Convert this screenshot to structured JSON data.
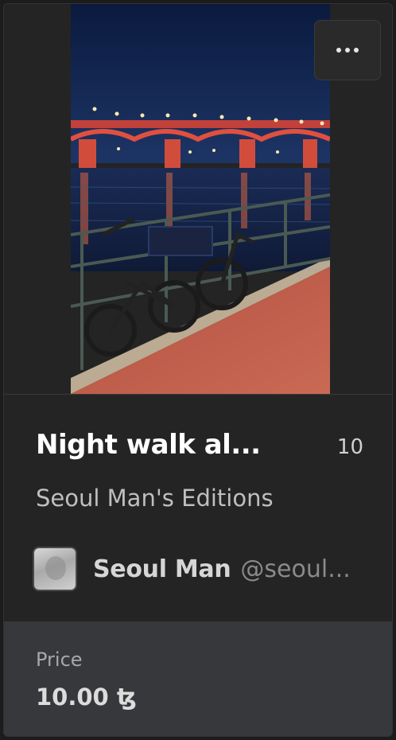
{
  "nft": {
    "title": "Night walk al...",
    "edition_count": "10",
    "collection": "Seoul Man's Editions",
    "image_description_icon": "photo-bridge-night",
    "creator": {
      "name": "Seoul Man",
      "handle": "@seoul..."
    },
    "price_label": "Price",
    "price_value": "10.00 ꜩ"
  },
  "icons": {
    "more": "more-horizontal-icon"
  },
  "colors": {
    "card_bg": "#242424",
    "footer_bg": "#37383b",
    "title": "#ffffff",
    "muted": "#bfbfbf",
    "handle": "#8a8a8a"
  }
}
